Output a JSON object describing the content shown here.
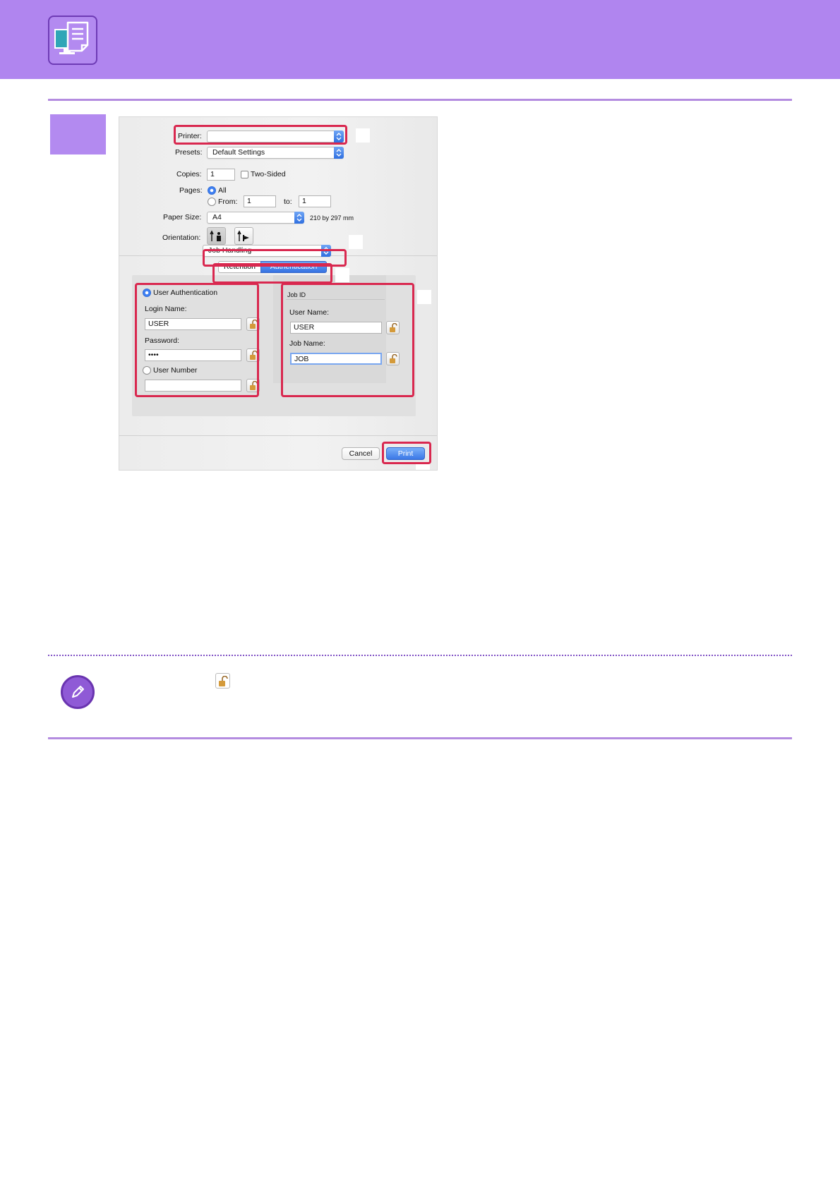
{
  "colors": {
    "header": "#b085ef",
    "rule": "#b48ce0",
    "highlight": "#d9284f",
    "accent_blue": "#3b77e6"
  },
  "icons": {
    "header": "computer-printing-icon",
    "note": "pencil-icon",
    "lock": "padlock-icon"
  },
  "dialog": {
    "printer_label": "Printer:",
    "printer_value": "",
    "presets_label": "Presets:",
    "presets_value": "Default Settings",
    "copies_label": "Copies:",
    "copies_value": "1",
    "two_sided_label": "Two-Sided",
    "pages_label": "Pages:",
    "pages_all_label": "All",
    "pages_from_label": "From:",
    "pages_from_value": "1",
    "pages_to_label": "to:",
    "pages_to_value": "1",
    "paper_size_label": "Paper Size:",
    "paper_size_value": "A4",
    "paper_size_dims": "210 by 297 mm",
    "orientation_label": "Orientation:",
    "section_value": "Job Handling",
    "tabs": [
      "Retention",
      "Authentication"
    ],
    "user_auth_label": "User Authentication",
    "login_name_label": "Login Name:",
    "login_name_value": "USER",
    "password_label": "Password:",
    "password_value": "••••",
    "user_number_label": "User Number",
    "user_number_value": "",
    "job_id_title": "Job ID",
    "user_name_label": "User Name:",
    "user_name_value": "USER",
    "job_name_label": "Job Name:",
    "job_name_value": "JOB",
    "cancel_label": "Cancel",
    "print_label": "Print"
  }
}
